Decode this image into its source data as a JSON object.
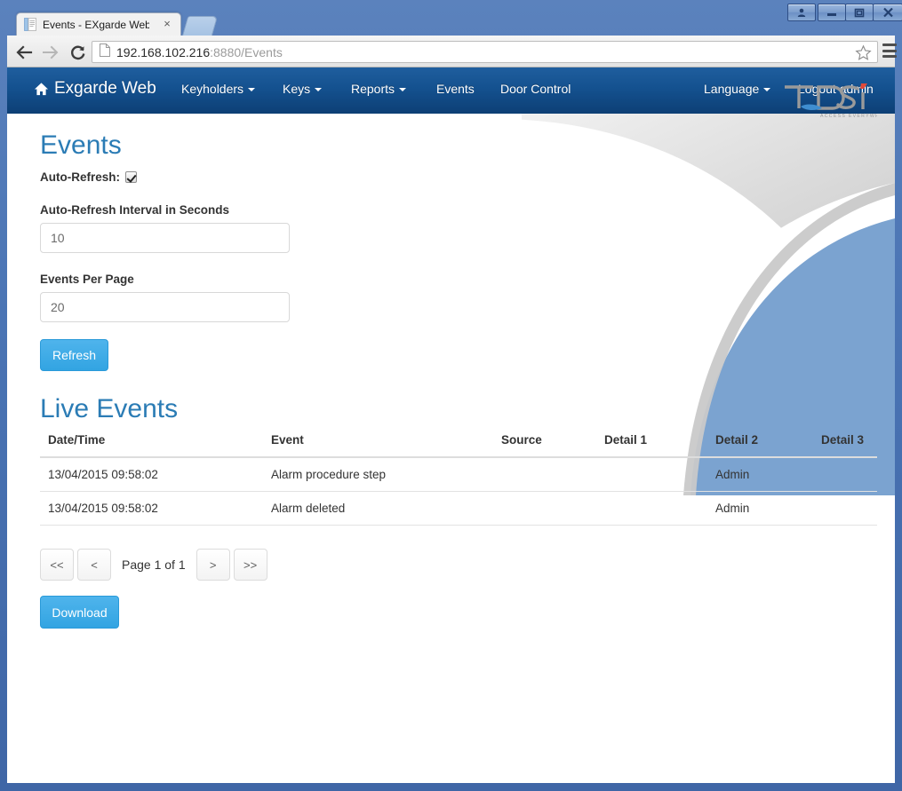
{
  "window": {
    "buttons": {
      "user_label": "user-account",
      "minimize_label": "Minimize",
      "maximize_label": "Maximize",
      "close_label": "Close"
    }
  },
  "browser": {
    "tab": {
      "title": "Events - EXgarde Web",
      "close_label": "×"
    },
    "new_tab_label": "New Tab",
    "nav": {
      "back_label": "Back",
      "forward_label": "Forward",
      "reload_label": "Reload"
    },
    "url": {
      "host": "192.168.102.216",
      "rest": ":8880/Events",
      "full": "192.168.102.216:8880/Events"
    },
    "bookmark_label": "Bookmark this page",
    "menu_label": "Customize and control"
  },
  "navbar": {
    "brand": "Exgarde Web",
    "items": [
      {
        "label": "Keyholders",
        "caret": true
      },
      {
        "label": "Keys",
        "caret": true
      },
      {
        "label": "Reports",
        "caret": true
      },
      {
        "label": "Events",
        "caret": false
      },
      {
        "label": "Door Control",
        "caret": false
      }
    ],
    "right_items": [
      {
        "label": "Language",
        "caret": true
      },
      {
        "label": "Logout admin",
        "caret": false
      }
    ],
    "bg_color": "#14518f"
  },
  "page": {
    "title": "Events",
    "auto_refresh_label": "Auto-Refresh:",
    "auto_refresh_checked": true,
    "interval_label": "Auto-Refresh Interval in Seconds",
    "interval_value": "10",
    "per_page_label": "Events Per Page",
    "per_page_value": "20",
    "refresh_button": "Refresh",
    "live_events_title": "Live Events",
    "download_button": "Download",
    "accent_color": "#2b7cb5",
    "button_color": "#32a4e2"
  },
  "table": {
    "columns": [
      "Date/Time",
      "Event",
      "Source",
      "Detail 1",
      "Detail 2",
      "Detail 3"
    ],
    "rows": [
      {
        "datetime": "13/04/2015 09:58:02",
        "event": "Alarm procedure step",
        "source": "",
        "detail1": "",
        "detail2": "Admin",
        "detail3": ""
      },
      {
        "datetime": "13/04/2015 09:58:02",
        "event": "Alarm deleted",
        "source": "",
        "detail1": "",
        "detail2": "Admin",
        "detail3": ""
      }
    ]
  },
  "pagination": {
    "first": "<<",
    "prev": "<",
    "label": "Page 1 of 1",
    "next": ">",
    "last": ">>"
  },
  "logo": {
    "text": "TDSi",
    "tagline": "ACCESS EVERYWHERE"
  }
}
